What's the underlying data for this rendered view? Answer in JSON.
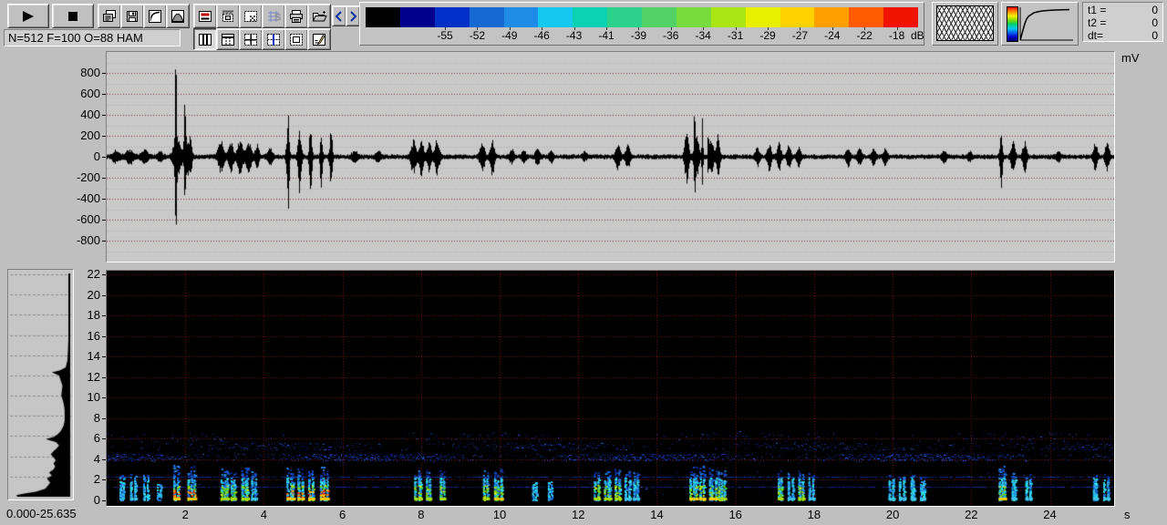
{
  "app_background": "#bfbfbf",
  "toolbar": {
    "status_text": "N=512 F=100 O=88 HAM",
    "buttons_row1": [
      "play-button",
      "stop-button",
      "copy-display-button",
      "save-button",
      "transfer-curve-button",
      "window-function-button",
      "display-mode-button",
      "measure-select-button",
      "crop-select-button",
      "scale-grid-button",
      "print-button",
      "open-file-button",
      "prev-button",
      "next-button"
    ],
    "buttons_row2": [
      "layout-columns-button",
      "layout-header-button",
      "layout-cross-button",
      "layout-cross-marker-button",
      "layout-inner-frame-button",
      "edit-notes-button"
    ]
  },
  "colorbar": {
    "labels": [
      "-55",
      "-52",
      "-49",
      "-46",
      "-43",
      "-41",
      "-39",
      "-36",
      "-34",
      "-31",
      "-29",
      "-27",
      "-24",
      "-22",
      "-18"
    ],
    "unit": "dB",
    "colors": [
      "#000000",
      "#00008c",
      "#0030c8",
      "#1569d2",
      "#1e8ce6",
      "#14c8f0",
      "#0cd2b4",
      "#2cd28c",
      "#50d264",
      "#78dc3c",
      "#aae614",
      "#e6f000",
      "#ffd200",
      "#ffa000",
      "#ff5a00",
      "#f01400"
    ]
  },
  "panels": {
    "window_overlap_icon": "overlapping-windows-pattern",
    "transfer_curve": {
      "palette_vertical": [
        "#ff0000",
        "#ff8800",
        "#ffee00",
        "#88dd00",
        "#00cc66",
        "#00ccee",
        "#0066ee",
        "#0000cc",
        "#000066"
      ],
      "curve": [
        [
          0,
          0
        ],
        [
          3,
          11
        ],
        [
          5,
          18
        ],
        [
          7,
          23
        ],
        [
          9,
          26
        ],
        [
          12,
          28
        ],
        [
          15,
          30
        ],
        [
          19,
          31
        ],
        [
          24,
          32
        ],
        [
          30,
          32.5
        ],
        [
          38,
          33
        ],
        [
          54,
          33.5
        ]
      ]
    },
    "time_readout": {
      "rows": [
        {
          "label": "t1 =",
          "value": "0"
        },
        {
          "label": "t2 =",
          "value": "0"
        },
        {
          "label": "dt=",
          "value": "0"
        }
      ]
    }
  },
  "chart_data": [
    {
      "type": "line",
      "title": "oscillogram",
      "ylabel": "mV",
      "xlim": [
        0,
        25.635
      ],
      "ylim": [
        -1000,
        1000
      ],
      "yticks": [
        800,
        600,
        400,
        200,
        0,
        -200,
        -400,
        -600,
        -800
      ],
      "grid": "dotted maroon every 200 mV, faint gray every 100 mV",
      "noise_floor_mv": 25,
      "bursts": [
        [
          0.22,
          55,
          55,
          0.1
        ],
        [
          0.57,
          65,
          65,
          0.12
        ],
        [
          0.95,
          60,
          60,
          0.1
        ],
        [
          1.35,
          40,
          40,
          0.08
        ],
        [
          1.75,
          950,
          780,
          0.018
        ],
        [
          1.78,
          230,
          230,
          0.1
        ],
        [
          1.98,
          420,
          300,
          0.02
        ],
        [
          2.02,
          180,
          180,
          0.08
        ],
        [
          2.12,
          150,
          150,
          0.05
        ],
        [
          2.9,
          150,
          150,
          0.09
        ],
        [
          3.15,
          140,
          140,
          0.07
        ],
        [
          3.38,
          165,
          165,
          0.08
        ],
        [
          3.6,
          150,
          150,
          0.08
        ],
        [
          3.82,
          110,
          110,
          0.06
        ],
        [
          4.15,
          70,
          70,
          0.08
        ],
        [
          4.6,
          300,
          380,
          0.04
        ],
        [
          4.62,
          420,
          460,
          0.015
        ],
        [
          4.9,
          280,
          350,
          0.05
        ],
        [
          5.18,
          300,
          330,
          0.04
        ],
        [
          5.45,
          300,
          430,
          0.03
        ],
        [
          5.7,
          260,
          300,
          0.04
        ],
        [
          6.3,
          55,
          55,
          0.08
        ],
        [
          6.9,
          45,
          45,
          0.08
        ],
        [
          7.8,
          150,
          160,
          0.08
        ],
        [
          8.0,
          175,
          175,
          0.06
        ],
        [
          8.2,
          140,
          140,
          0.06
        ],
        [
          8.4,
          165,
          165,
          0.07
        ],
        [
          9.55,
          145,
          145,
          0.07
        ],
        [
          9.8,
          185,
          185,
          0.06
        ],
        [
          10.3,
          70,
          70,
          0.06
        ],
        [
          10.6,
          60,
          60,
          0.06
        ],
        [
          10.95,
          90,
          90,
          0.06
        ],
        [
          11.3,
          60,
          60,
          0.06
        ],
        [
          12.15,
          40,
          40,
          0.06
        ],
        [
          13.0,
          115,
          115,
          0.07
        ],
        [
          13.25,
          105,
          105,
          0.07
        ],
        [
          14.75,
          270,
          250,
          0.06
        ],
        [
          14.95,
          430,
          440,
          0.015
        ],
        [
          15.0,
          230,
          230,
          0.07
        ],
        [
          15.15,
          370,
          350,
          0.02
        ],
        [
          15.3,
          430,
          340,
          0.012
        ],
        [
          15.38,
          200,
          200,
          0.06
        ],
        [
          15.55,
          220,
          190,
          0.05
        ],
        [
          16.55,
          85,
          85,
          0.06
        ],
        [
          16.85,
          125,
          125,
          0.06
        ],
        [
          17.1,
          135,
          135,
          0.06
        ],
        [
          17.35,
          115,
          115,
          0.06
        ],
        [
          17.6,
          90,
          90,
          0.06
        ],
        [
          18.85,
          95,
          95,
          0.06
        ],
        [
          19.15,
          75,
          75,
          0.06
        ],
        [
          19.5,
          85,
          85,
          0.06
        ],
        [
          19.8,
          75,
          75,
          0.06
        ],
        [
          21.3,
          55,
          55,
          0.06
        ],
        [
          21.95,
          45,
          45,
          0.06
        ],
        [
          22.75,
          240,
          300,
          0.04
        ],
        [
          23.05,
          155,
          155,
          0.06
        ],
        [
          23.35,
          145,
          145,
          0.06
        ],
        [
          24.2,
          45,
          45,
          0.06
        ],
        [
          25.15,
          125,
          125,
          0.06
        ],
        [
          25.45,
          135,
          135,
          0.06
        ]
      ]
    },
    {
      "type": "heatmap",
      "title": "spectrogram",
      "xunit": "s",
      "xlim": [
        0,
        25.635
      ],
      "ylim": [
        0,
        22
      ],
      "xticks": [
        2,
        4,
        6,
        8,
        10,
        12,
        14,
        16,
        18,
        20,
        22,
        24
      ],
      "yticks": [
        0,
        2,
        4,
        6,
        8,
        10,
        12,
        14,
        16,
        18,
        20,
        22
      ],
      "grid_color": "#7d1818",
      "background": "#000000",
      "noise_bands": [
        {
          "f1": 3.85,
          "f2": 4.55,
          "d": 0.9
        },
        {
          "f1": 4.9,
          "f2": 5.6,
          "d": 0.33
        },
        {
          "f1": 5.7,
          "f2": 6.6,
          "d": 0.14
        },
        {
          "f1": 0.2,
          "f2": 6.8,
          "d": 0.05
        }
      ],
      "noise_lines_khz": [
        1.35,
        2.3
      ],
      "events": [
        [
          0.35,
          2.6,
          1
        ],
        [
          0.62,
          2.9,
          1.5
        ],
        [
          0.95,
          2.7,
          1
        ],
        [
          1.3,
          2.0,
          0.8
        ],
        [
          1.72,
          3.6,
          3
        ],
        [
          2.08,
          3.5,
          3
        ],
        [
          2.92,
          3.1,
          2
        ],
        [
          3.18,
          3.0,
          2
        ],
        [
          3.45,
          3.3,
          2
        ],
        [
          3.7,
          2.9,
          1.5
        ],
        [
          4.6,
          3.2,
          3
        ],
        [
          4.88,
          3.2,
          3
        ],
        [
          5.15,
          3.1,
          3
        ],
        [
          5.45,
          3.3,
          3
        ],
        [
          7.85,
          3.0,
          2
        ],
        [
          8.15,
          3.1,
          2
        ],
        [
          8.5,
          3.0,
          2
        ],
        [
          9.6,
          3.0,
          2
        ],
        [
          9.88,
          3.2,
          2.5
        ],
        [
          10.85,
          2.1,
          1
        ],
        [
          11.25,
          1.9,
          1
        ],
        [
          12.42,
          3.1,
          2
        ],
        [
          12.68,
          3.0,
          2
        ],
        [
          12.95,
          3.2,
          2
        ],
        [
          13.2,
          2.9,
          1.5
        ],
        [
          13.42,
          2.8,
          1.5
        ],
        [
          14.85,
          3.3,
          2.5
        ],
        [
          15.1,
          3.4,
          2.5
        ],
        [
          15.35,
          3.2,
          2.5
        ],
        [
          15.58,
          3.0,
          2
        ],
        [
          17.1,
          3.0,
          2
        ],
        [
          17.35,
          2.9,
          1.5
        ],
        [
          17.62,
          3.0,
          2
        ],
        [
          17.88,
          2.8,
          1.5
        ],
        [
          19.92,
          2.6,
          1.5
        ],
        [
          20.18,
          2.8,
          1.5
        ],
        [
          20.48,
          2.6,
          1.5
        ],
        [
          20.72,
          2.4,
          1.5
        ],
        [
          22.72,
          3.6,
          2.5
        ],
        [
          23.05,
          2.8,
          1.5
        ],
        [
          23.4,
          2.6,
          1.5
        ],
        [
          25.12,
          2.6,
          1.5
        ],
        [
          25.38,
          2.6,
          1.5
        ]
      ]
    },
    {
      "type": "area",
      "title": "average spectrum",
      "range_label": "0.000-25.635",
      "flim": [
        0,
        22
      ],
      "avg_spectrum_points": [
        [
          0,
          0.95
        ],
        [
          0.15,
          0.97
        ],
        [
          0.3,
          0.85
        ],
        [
          0.5,
          0.62
        ],
        [
          0.8,
          0.45
        ],
        [
          1.1,
          0.4
        ],
        [
          1.4,
          0.36
        ],
        [
          1.8,
          0.42
        ],
        [
          2.1,
          0.33
        ],
        [
          2.4,
          0.38
        ],
        [
          2.7,
          0.3
        ],
        [
          3.0,
          0.27
        ],
        [
          3.3,
          0.3
        ],
        [
          3.6,
          0.26
        ],
        [
          3.9,
          0.3
        ],
        [
          4.2,
          0.35
        ],
        [
          4.5,
          0.3
        ],
        [
          4.8,
          0.24
        ],
        [
          5.1,
          0.2
        ],
        [
          5.4,
          0.26
        ],
        [
          5.7,
          0.44
        ],
        [
          5.9,
          0.3
        ],
        [
          6.2,
          0.22
        ],
        [
          6.5,
          0.17
        ],
        [
          7.0,
          0.12
        ],
        [
          7.5,
          0.1
        ],
        [
          8.0,
          0.1
        ],
        [
          8.5,
          0.1
        ],
        [
          9.0,
          0.11
        ],
        [
          9.5,
          0.13
        ],
        [
          10.0,
          0.16
        ],
        [
          10.5,
          0.15
        ],
        [
          11.0,
          0.14
        ],
        [
          11.5,
          0.17
        ],
        [
          12.0,
          0.2
        ],
        [
          12.3,
          0.33
        ],
        [
          12.5,
          0.18
        ],
        [
          12.8,
          0.08
        ],
        [
          13.5,
          0.05
        ],
        [
          14.5,
          0.04
        ],
        [
          16,
          0.03
        ],
        [
          18,
          0.025
        ],
        [
          20,
          0.02
        ],
        [
          22,
          0.015
        ]
      ]
    }
  ]
}
